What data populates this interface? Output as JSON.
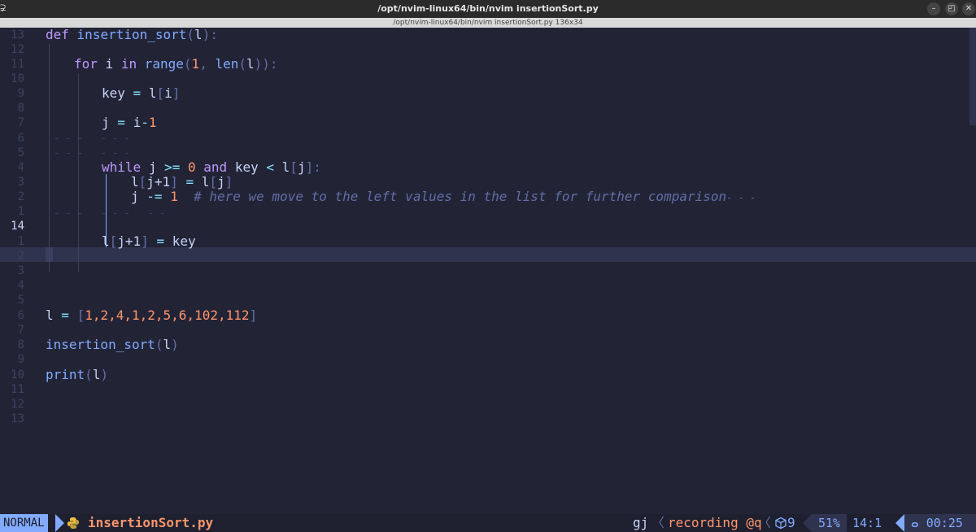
{
  "window": {
    "title": "/opt/nvim-linux64/bin/nvim insertionSort.py",
    "tab_title": "/opt/nvim-linux64/bin/nvim insertionSort.py 136x34",
    "tab_marker": "⊋"
  },
  "gutter": [
    "13",
    "12",
    "11",
    "10",
    "9",
    "8",
    "7",
    "6",
    "5",
    "4",
    "3",
    "2",
    "1",
    "14",
    "1",
    "2",
    "3",
    "4",
    "5",
    "6",
    "7",
    "8",
    "9",
    "10",
    "11",
    "12",
    "13"
  ],
  "code": {
    "def_kw": "def",
    "def_name": "insertion_sort",
    "def_param": "l",
    "for_kw": "for",
    "for_var": "i",
    "in_kw": "in",
    "range_fn": "range",
    "range_start": "1",
    "len_fn": "len",
    "len_arg": "l",
    "key_assign": "key",
    "key_rhs_list": "l",
    "key_rhs_idx": "i",
    "j_assign": "j",
    "j_rhs_i": "i",
    "j_rhs_num": "1",
    "while_kw": "while",
    "while_j": "j",
    "while_op": ">=",
    "while_zero": "0",
    "and_kw": "and",
    "while_key": "key",
    "while_lt": "<",
    "while_l": "l",
    "while_idx": "j",
    "shift_lhs": "l",
    "shift_idx": "j+1",
    "shift_rhs_l": "l",
    "shift_rhs_j": "j",
    "dec_j": "j",
    "dec_op": "-=",
    "dec_num": "1",
    "comment": "# here we move to the left values in the list for further comparison",
    "final_lhs": "l",
    "final_idx": "j+1",
    "final_rhs": "key",
    "list_name": "l",
    "list_values": "1,2,4,1,2,5,6,102,112",
    "call_fn": "insertion_sort",
    "call_arg": "l",
    "print_fn": "print",
    "print_arg": "l"
  },
  "statusline": {
    "mode": "NORMAL",
    "filename": "insertionSort.py",
    "keys": "gj",
    "recording": "recording @q",
    "diagnostics": "9",
    "percent": "51%",
    "position": "14:1",
    "time": "00:25",
    "time_icon": "ⴰ"
  },
  "colors": {
    "background": "#222436",
    "keyword": "#c099ff",
    "function": "#82aaff",
    "number": "#ff966c",
    "comment": "#636da6",
    "mode_bg": "#82aaff"
  }
}
